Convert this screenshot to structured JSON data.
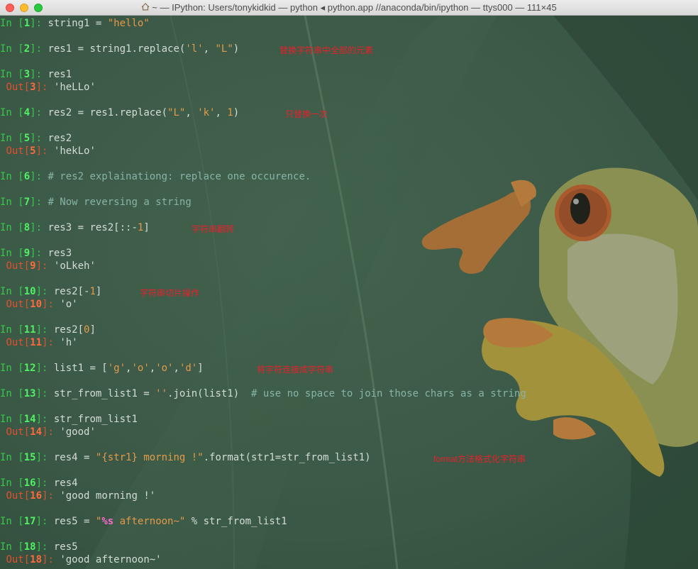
{
  "window": {
    "title": "~ — IPython: Users/tonykidkid — python ◂ python.app //anaconda/bin/ipython — ttys000 — 111×45"
  },
  "cells": {
    "c1": {
      "in": "In [",
      "n": "1",
      "close": "]:",
      "code": "string1 = ",
      "s1": "\"hello\""
    },
    "c2": {
      "in": "In [",
      "n": "2",
      "close": "]:",
      "code": "res1 = string1.replace(",
      "s1": "'l'",
      "sep": ", ",
      "s2": "\"L\"",
      "end": ")"
    },
    "c3": {
      "in": "In [",
      "n": "3",
      "close": "]:",
      "code": "res1",
      "out": "Out[",
      "out_close": "]:",
      "out_val": "'heLLo'"
    },
    "c4": {
      "in": "In [",
      "n": "4",
      "close": "]:",
      "code": "res2 = res1.replace(",
      "s1": "\"L\"",
      "sep": ", ",
      "s2": "'k'",
      "sep2": ", ",
      "num": "1",
      "end": ")"
    },
    "c5": {
      "in": "In [",
      "n": "5",
      "close": "]:",
      "code": "res2",
      "out": "Out[",
      "out_close": "]:",
      "out_val": "'hekLo'"
    },
    "c6": {
      "in": "In [",
      "n": "6",
      "close": "]:",
      "comment": "# res2 explainationg: replace one occurence."
    },
    "c7": {
      "in": "In [",
      "n": "7",
      "close": "]:",
      "comment": "# Now reversing a string"
    },
    "c8": {
      "in": "In [",
      "n": "8",
      "close": "]:",
      "code": "res3 = res2[::-",
      "num": "1",
      "end": "]"
    },
    "c9": {
      "in": "In [",
      "n": "9",
      "close": "]:",
      "code": "res3",
      "out": "Out[",
      "out_close": "]:",
      "out_val": "'oLkeh'"
    },
    "c10": {
      "in": "In [",
      "n": "10",
      "close": "]:",
      "code": "res2[-",
      "num": "1",
      "end": "]",
      "out": "Out[",
      "out_close": "]:",
      "out_val": "'o'"
    },
    "c11": {
      "in": "In [",
      "n": "11",
      "close": "]:",
      "code": "res2[",
      "num": "0",
      "end": "]",
      "out": "Out[",
      "out_close": "]:",
      "out_val": "'h'"
    },
    "c12": {
      "in": "In [",
      "n": "12",
      "close": "]:",
      "code": "list1 = [",
      "s1": "'g'",
      "s2": "'o'",
      "s3": "'o'",
      "s4": "'d'",
      "comma": ",",
      "end": "]"
    },
    "c13": {
      "in": "In [",
      "n": "13",
      "close": "]:",
      "code": "str_from_list1 = ",
      "s1": "''",
      "mid": ".join(list1)  ",
      "comment": "# use no space to join those chars as a string"
    },
    "c14": {
      "in": "In [",
      "n": "14",
      "close": "]:",
      "code": "str_from_list1",
      "out": "Out[",
      "out_close": "]:",
      "out_val": "'good'"
    },
    "c15": {
      "in": "In [",
      "n": "15",
      "close": "]:",
      "code": "res4 = ",
      "s1": "\"{str1} morning !\"",
      "end": ".format(str1=str_from_list1)"
    },
    "c16": {
      "in": "In [",
      "n": "16",
      "close": "]:",
      "code": "res4",
      "out": "Out[",
      "out_close": "]:",
      "out_val": "'good morning !'"
    },
    "c17": {
      "in": "In [",
      "n": "17",
      "close": "]:",
      "code": "res5 = ",
      "q1": "\"",
      "fmt": "%s",
      "s1": " afternoon~\"",
      "end": " % str_from_list1"
    },
    "c18": {
      "in": "In [",
      "n": "18",
      "close": "]:",
      "code": "res5",
      "out": "Out[",
      "out_close": "]:",
      "out_val": "'good afternoon~'"
    }
  },
  "annotations": {
    "a2": "替换字符串中全部的元素",
    "a4": "只替换一次",
    "a8": "字符串翻转",
    "a10": "字符串切片操作",
    "a12": "将字符连接成字符串",
    "a15": "format方法格式化字符串"
  },
  "colors": {
    "prompt_in": "#36c94a",
    "prompt_out": "#e2502d",
    "string": "#e59a4a",
    "annotation": "#e8202a"
  }
}
